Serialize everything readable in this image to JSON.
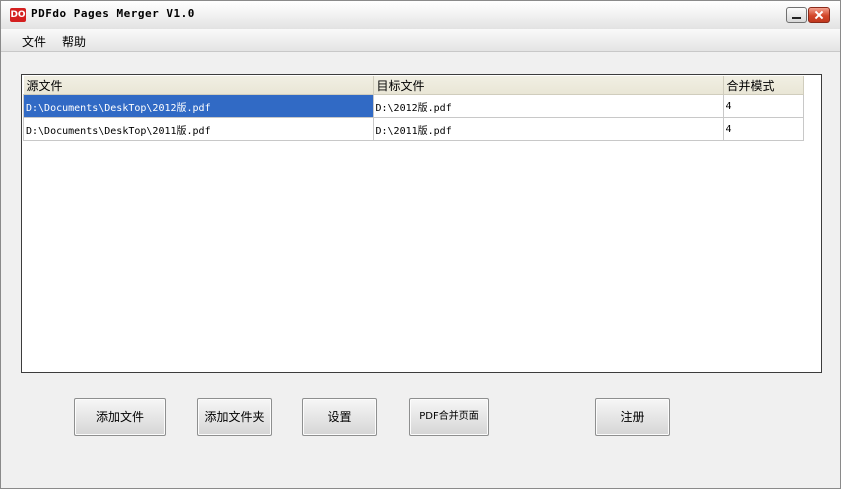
{
  "window": {
    "title": "PDFdo Pages Merger V1.0",
    "icon_text": "DO"
  },
  "menu": {
    "items": [
      "文件",
      "帮助"
    ]
  },
  "table": {
    "columns": [
      "源文件",
      "目标文件",
      "合并模式"
    ],
    "rows": [
      {
        "source": "D:\\Documents\\DeskTop\\2012版.pdf",
        "target": "D:\\2012版.pdf",
        "mode": "4"
      },
      {
        "source": "D:\\Documents\\DeskTop\\2011版.pdf",
        "target": "D:\\2011版.pdf",
        "mode": "4"
      }
    ],
    "selected_row": 0
  },
  "buttons": {
    "add_file": "添加文件",
    "add_folder": "添加文件夹",
    "settings": "设置",
    "merge_pages": "PDF合并页面",
    "register": "注册"
  },
  "colors": {
    "selection": "#316ac5",
    "header_bg": "#ece9d8",
    "close_button": "#d2462a"
  }
}
